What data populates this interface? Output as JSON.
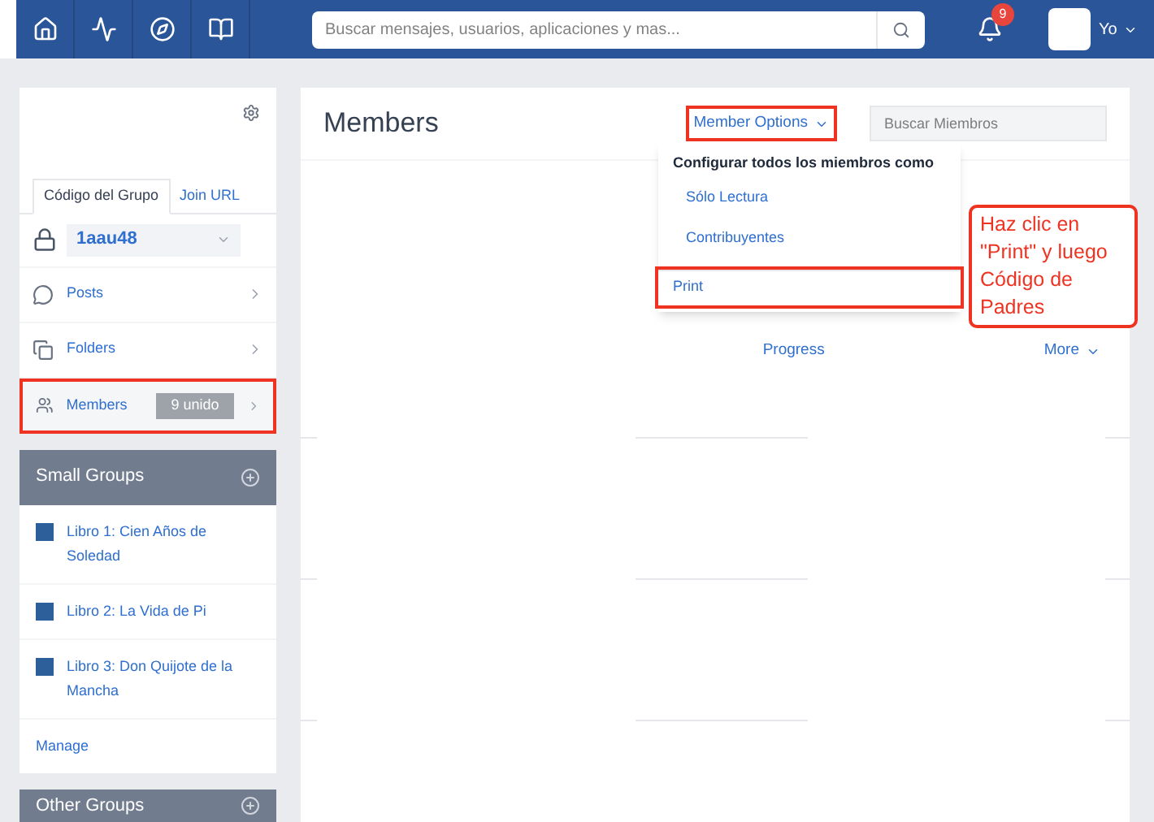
{
  "nav": {
    "search": {
      "placeholder": "Buscar mensajes, usuarios, aplicaciones y mas..."
    },
    "notifications": "9",
    "user": "Yo"
  },
  "sidebar": {
    "tabs": [
      {
        "label": "Código del Grupo",
        "selected": true
      },
      {
        "label": "Join URL",
        "selected": false
      }
    ],
    "group_code": "1aau48",
    "items": [
      {
        "kind": "posts",
        "label": "Posts",
        "highlighted": false
      },
      {
        "kind": "folders",
        "label": "Folders",
        "highlighted": false
      },
      {
        "kind": "members",
        "label": "Members",
        "badge": "9 unido",
        "highlighted": true
      }
    ],
    "small_groups": {
      "title": "Small Groups",
      "items": [
        {
          "label": "Libro 1: Cien Años de Soledad",
          "color": "#2d5f9a"
        },
        {
          "label": "Libro 2: La Vida de Pi",
          "color": "#2d5f9a"
        },
        {
          "label": "Libro 3: Don Quijote de la Mancha",
          "color": "#2d5f9a"
        }
      ],
      "manage": "Manage"
    },
    "other_groups": {
      "title": "Other Groups"
    }
  },
  "main": {
    "title": "Members",
    "member_options": {
      "label": "Member Options",
      "highlighted": true
    },
    "search": {
      "placeholder": "Buscar Miembros"
    },
    "menu": {
      "header": "Configurar todos los miembros como",
      "items": [
        {
          "label": "Sólo Lectura",
          "highlighted": false
        },
        {
          "label": "Contribuyentes",
          "highlighted": false
        },
        {
          "label": "Print",
          "highlighted": true
        }
      ]
    },
    "columns": [
      "Progress",
      "More"
    ]
  },
  "callout": "Haz clic en \"Print\" y luego Código de Padres"
}
